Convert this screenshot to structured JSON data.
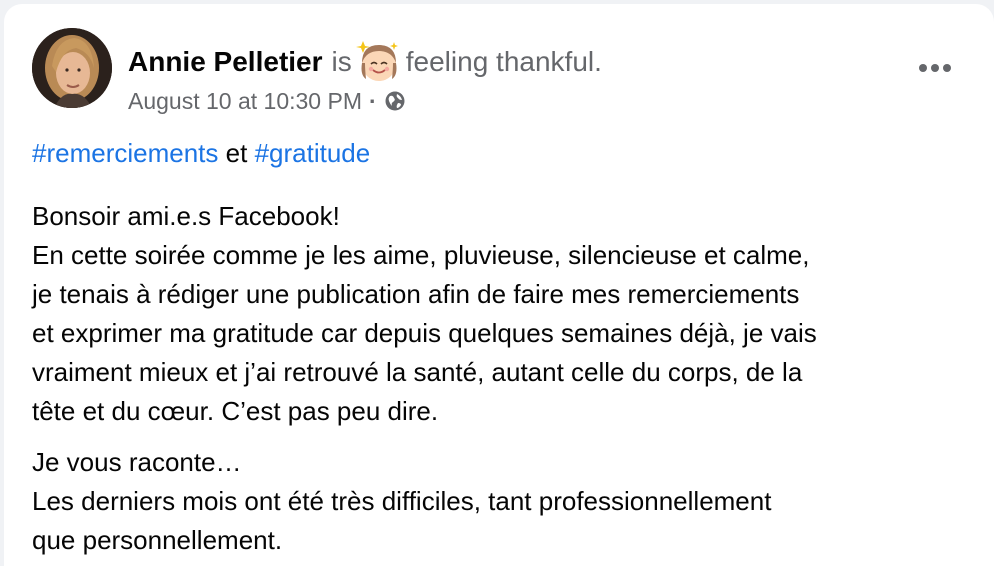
{
  "post": {
    "author": {
      "name": "Annie Pelletier",
      "avatar_icon": "profile-photo"
    },
    "feeling": {
      "prefix": "is",
      "text": "feeling thankful.",
      "emoji_icon": "smiling-face-with-halo-emoji"
    },
    "timestamp": "August 10 at 10:30 PM",
    "separator": "·",
    "privacy_icon": "globe-icon",
    "more_icon": "more-options-icon",
    "hashtags": {
      "first": "#remerciements",
      "connector": "et",
      "second": "#gratitude"
    },
    "paragraphs": [
      {
        "lines": [
          "Bonsoir ami.e.s Facebook!",
          "En cette soirée comme je les aime, pluvieuse, silencieuse et calme,",
          "je tenais à rédiger une publication afin de faire mes remerciements",
          "et exprimer ma gratitude car depuis quelques semaines déjà, je vais",
          "vraiment mieux et j’ai retrouvé la santé, autant celle du corps, de la",
          "tête et du cœur. C’est pas peu dire."
        ]
      },
      {
        "lines": [
          "Je vous raconte…",
          "Les derniers mois ont été très difficiles, tant professionnellement",
          "que personnellement."
        ]
      }
    ],
    "colors": {
      "link": "#1b74e4",
      "text": "#050505",
      "secondary": "#65676b",
      "background": "#ffffff"
    }
  }
}
